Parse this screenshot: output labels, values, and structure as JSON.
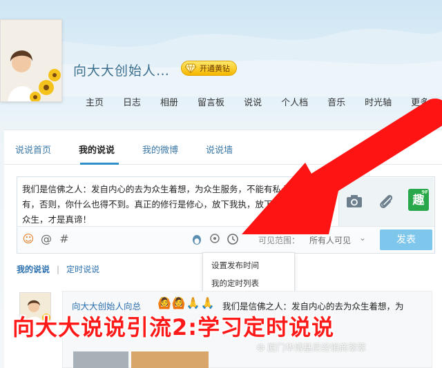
{
  "profile": {
    "nickname": "向大大创始人…",
    "vip_label": "开通黄钻"
  },
  "nav": {
    "items": [
      "主页",
      "日志",
      "相册",
      "留言板",
      "说说",
      "个人档",
      "音乐",
      "时光轴",
      "更多"
    ]
  },
  "tabs": {
    "items": [
      "说说首页",
      "我的说说",
      "我的微博",
      "说说墙"
    ],
    "active_index": 1
  },
  "composer": {
    "text": "我们是信佛之人：发自内心的去为众生着想，为众生服务，不能有私心，更不能占有，否则，你什么也得不到。真正的修行是修心，放下我执，放下贪心，普度一切众生，才是真谛！",
    "visibility_label": "可见范围：",
    "visibility_value": "所有人可见",
    "publish_label": "发表",
    "tool_badge": "趣",
    "tool_badge_tag": "9F"
  },
  "schedule_menu": {
    "items": [
      "设置发布时间",
      "我的定时列表"
    ]
  },
  "filters": {
    "my_posts": "我的说说",
    "separator": "|",
    "timed_posts": "定时说说"
  },
  "post": {
    "author": "向大大创始人向总",
    "emojis": "🙆🙆🙏🙏",
    "text": "我们是信佛之人：发自内心的去为众生着想，为"
  },
  "overlay": {
    "caption": "向大大说说引流2:学习定时说说",
    "watermark": "厦门华博基尼经销商翠翠"
  },
  "colors": {
    "accent": "#2e8fc9",
    "publish": "#7ec6ec",
    "arrow": "#ff1414",
    "vip": "#f5b700"
  }
}
